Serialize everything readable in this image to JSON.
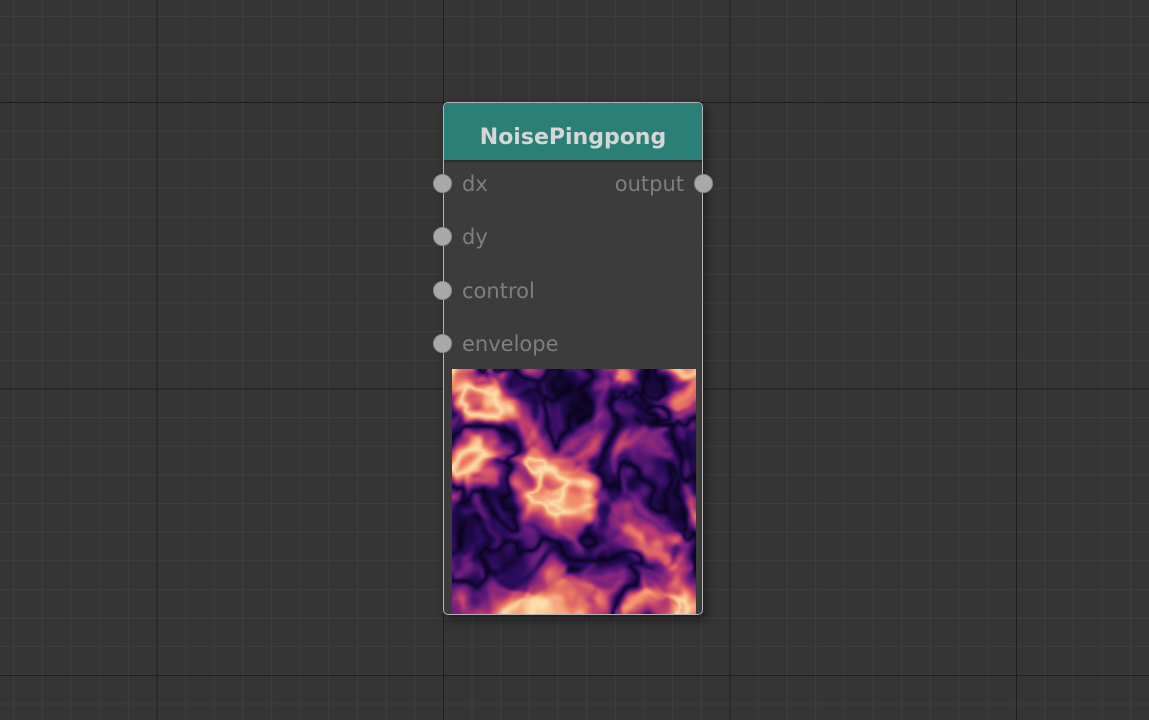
{
  "node": {
    "title": "NoisePingpong",
    "inputs": [
      {
        "label": "dx"
      },
      {
        "label": "dy"
      },
      {
        "label": "control"
      },
      {
        "label": "envelope"
      }
    ],
    "outputs": [
      {
        "label": "output"
      }
    ],
    "header_color": "#2a8077",
    "preview_colormap": "magma"
  },
  "canvas": {
    "background_color": "#353535",
    "minor_grid_color": "#3f3f3f",
    "major_grid_color": "#1e1e1e"
  }
}
